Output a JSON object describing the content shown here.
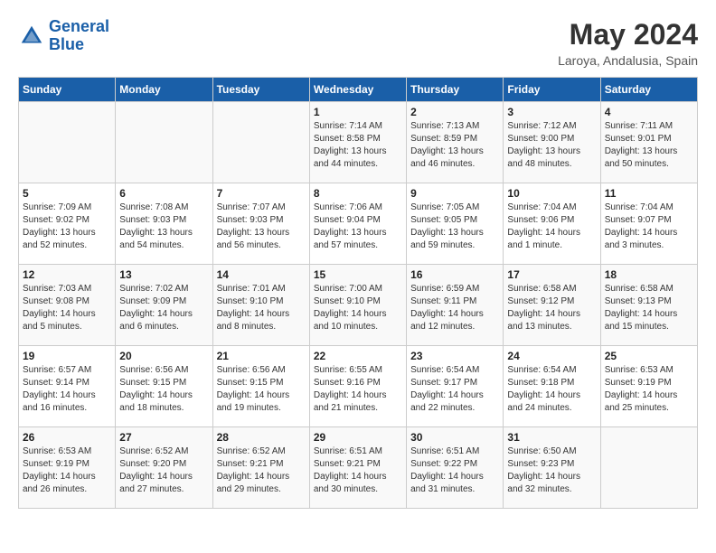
{
  "header": {
    "logo_line1": "General",
    "logo_line2": "Blue",
    "month_year": "May 2024",
    "location": "Laroya, Andalusia, Spain"
  },
  "weekdays": [
    "Sunday",
    "Monday",
    "Tuesday",
    "Wednesday",
    "Thursday",
    "Friday",
    "Saturday"
  ],
  "weeks": [
    [
      {
        "day": "",
        "info": ""
      },
      {
        "day": "",
        "info": ""
      },
      {
        "day": "",
        "info": ""
      },
      {
        "day": "1",
        "info": "Sunrise: 7:14 AM\nSunset: 8:58 PM\nDaylight: 13 hours\nand 44 minutes."
      },
      {
        "day": "2",
        "info": "Sunrise: 7:13 AM\nSunset: 8:59 PM\nDaylight: 13 hours\nand 46 minutes."
      },
      {
        "day": "3",
        "info": "Sunrise: 7:12 AM\nSunset: 9:00 PM\nDaylight: 13 hours\nand 48 minutes."
      },
      {
        "day": "4",
        "info": "Sunrise: 7:11 AM\nSunset: 9:01 PM\nDaylight: 13 hours\nand 50 minutes."
      }
    ],
    [
      {
        "day": "5",
        "info": "Sunrise: 7:09 AM\nSunset: 9:02 PM\nDaylight: 13 hours\nand 52 minutes."
      },
      {
        "day": "6",
        "info": "Sunrise: 7:08 AM\nSunset: 9:03 PM\nDaylight: 13 hours\nand 54 minutes."
      },
      {
        "day": "7",
        "info": "Sunrise: 7:07 AM\nSunset: 9:03 PM\nDaylight: 13 hours\nand 56 minutes."
      },
      {
        "day": "8",
        "info": "Sunrise: 7:06 AM\nSunset: 9:04 PM\nDaylight: 13 hours\nand 57 minutes."
      },
      {
        "day": "9",
        "info": "Sunrise: 7:05 AM\nSunset: 9:05 PM\nDaylight: 13 hours\nand 59 minutes."
      },
      {
        "day": "10",
        "info": "Sunrise: 7:04 AM\nSunset: 9:06 PM\nDaylight: 14 hours\nand 1 minute."
      },
      {
        "day": "11",
        "info": "Sunrise: 7:04 AM\nSunset: 9:07 PM\nDaylight: 14 hours\nand 3 minutes."
      }
    ],
    [
      {
        "day": "12",
        "info": "Sunrise: 7:03 AM\nSunset: 9:08 PM\nDaylight: 14 hours\nand 5 minutes."
      },
      {
        "day": "13",
        "info": "Sunrise: 7:02 AM\nSunset: 9:09 PM\nDaylight: 14 hours\nand 6 minutes."
      },
      {
        "day": "14",
        "info": "Sunrise: 7:01 AM\nSunset: 9:10 PM\nDaylight: 14 hours\nand 8 minutes."
      },
      {
        "day": "15",
        "info": "Sunrise: 7:00 AM\nSunset: 9:10 PM\nDaylight: 14 hours\nand 10 minutes."
      },
      {
        "day": "16",
        "info": "Sunrise: 6:59 AM\nSunset: 9:11 PM\nDaylight: 14 hours\nand 12 minutes."
      },
      {
        "day": "17",
        "info": "Sunrise: 6:58 AM\nSunset: 9:12 PM\nDaylight: 14 hours\nand 13 minutes."
      },
      {
        "day": "18",
        "info": "Sunrise: 6:58 AM\nSunset: 9:13 PM\nDaylight: 14 hours\nand 15 minutes."
      }
    ],
    [
      {
        "day": "19",
        "info": "Sunrise: 6:57 AM\nSunset: 9:14 PM\nDaylight: 14 hours\nand 16 minutes."
      },
      {
        "day": "20",
        "info": "Sunrise: 6:56 AM\nSunset: 9:15 PM\nDaylight: 14 hours\nand 18 minutes."
      },
      {
        "day": "21",
        "info": "Sunrise: 6:56 AM\nSunset: 9:15 PM\nDaylight: 14 hours\nand 19 minutes."
      },
      {
        "day": "22",
        "info": "Sunrise: 6:55 AM\nSunset: 9:16 PM\nDaylight: 14 hours\nand 21 minutes."
      },
      {
        "day": "23",
        "info": "Sunrise: 6:54 AM\nSunset: 9:17 PM\nDaylight: 14 hours\nand 22 minutes."
      },
      {
        "day": "24",
        "info": "Sunrise: 6:54 AM\nSunset: 9:18 PM\nDaylight: 14 hours\nand 24 minutes."
      },
      {
        "day": "25",
        "info": "Sunrise: 6:53 AM\nSunset: 9:19 PM\nDaylight: 14 hours\nand 25 minutes."
      }
    ],
    [
      {
        "day": "26",
        "info": "Sunrise: 6:53 AM\nSunset: 9:19 PM\nDaylight: 14 hours\nand 26 minutes."
      },
      {
        "day": "27",
        "info": "Sunrise: 6:52 AM\nSunset: 9:20 PM\nDaylight: 14 hours\nand 27 minutes."
      },
      {
        "day": "28",
        "info": "Sunrise: 6:52 AM\nSunset: 9:21 PM\nDaylight: 14 hours\nand 29 minutes."
      },
      {
        "day": "29",
        "info": "Sunrise: 6:51 AM\nSunset: 9:21 PM\nDaylight: 14 hours\nand 30 minutes."
      },
      {
        "day": "30",
        "info": "Sunrise: 6:51 AM\nSunset: 9:22 PM\nDaylight: 14 hours\nand 31 minutes."
      },
      {
        "day": "31",
        "info": "Sunrise: 6:50 AM\nSunset: 9:23 PM\nDaylight: 14 hours\nand 32 minutes."
      },
      {
        "day": "",
        "info": ""
      }
    ]
  ]
}
